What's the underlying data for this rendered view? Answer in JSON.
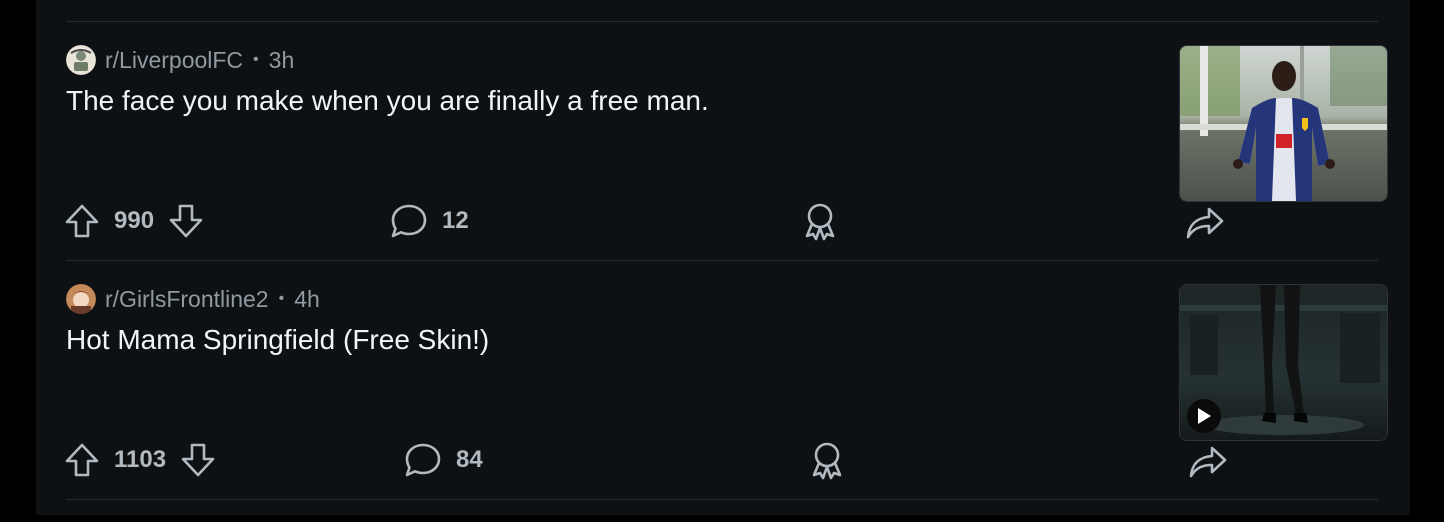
{
  "posts": [
    {
      "subreddit": "r/LiverpoolFC",
      "separator": "•",
      "age": "3h",
      "title": "The face you make when you are finally a free man.",
      "votes": "990",
      "comments": "12",
      "thumbnail": "photo",
      "avatar_icon": "liverpool-crest-icon"
    },
    {
      "subreddit": "r/GirlsFrontline2",
      "separator": "•",
      "age": "4h",
      "title": "Hot Mama Springfield (Free Skin!)",
      "votes": "1103",
      "comments": "84",
      "thumbnail": "video",
      "avatar_icon": "anime-avatar-icon"
    }
  ],
  "colors": {
    "background": "#0e1113",
    "text_primary": "#f2f4f5",
    "text_secondary": "#8f9aa1",
    "divider": "#272a2e"
  }
}
